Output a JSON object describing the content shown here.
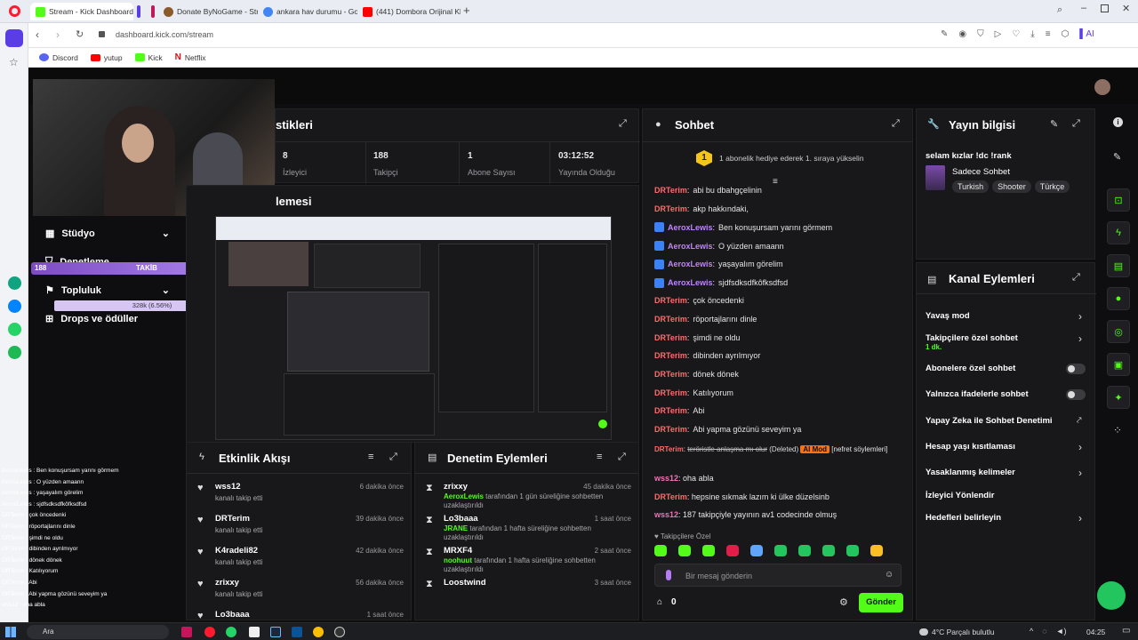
{
  "browser": {
    "tabs": [
      {
        "label": "Stream - Kick Dashboard",
        "active": true
      },
      {
        "label": "Donate ByNoGame - Strea"
      },
      {
        "label": "ankara hav durumu - Goo"
      },
      {
        "label": "(441) Dombora Orijinal Kl"
      }
    ],
    "url": "dashboard.kick.com/stream",
    "bookmarks": [
      "Discord",
      "yutup",
      "Kick",
      "Netflix"
    ]
  },
  "stats": {
    "title": "stikleri",
    "items": [
      {
        "value": "8",
        "label": "İzleyici"
      },
      {
        "value": "188",
        "label": "Takipçi"
      },
      {
        "value": "1",
        "label": "Abone Sayısı"
      },
      {
        "value": "03:12:52",
        "label": "Yayında Olduğu"
      }
    ]
  },
  "preview": {
    "title": "lemesi"
  },
  "left_nav": [
    {
      "label": "Stüdyo"
    },
    {
      "label": "Denetleme"
    },
    {
      "label": "Topluluk"
    },
    {
      "label": "Drops ve ödüller"
    }
  ],
  "follow_goal": {
    "left": "188",
    "center": "TAKİB",
    "right": "200",
    "sub": "328k (6.56%)"
  },
  "chat": {
    "title": "Sohbet",
    "banner": "1 abonelik hediye ederek 1. sıraya yükselin",
    "banner_badge": "1",
    "messages": [
      {
        "user": "DRTerim",
        "text": "abi bu dbahgçelinin",
        "color": "#ff6b6b"
      },
      {
        "user": "DRTerim",
        "text": "akp hakkındaki,",
        "color": "#ff6b6b"
      },
      {
        "user": "AeroxLewis",
        "text": "Ben konuşursam yarını görmem",
        "color": "#c084fc",
        "badge": true
      },
      {
        "user": "AeroxLewis",
        "text": "O yüzden amaann",
        "color": "#c084fc",
        "badge": true
      },
      {
        "user": "AeroxLewis",
        "text": "yaşayalım görelim",
        "color": "#c084fc",
        "badge": true
      },
      {
        "user": "AeroxLewis",
        "text": "sjdfsdksdfkôfksdfsd",
        "color": "#c084fc",
        "badge": true
      },
      {
        "user": "DRTerim",
        "text": "çok öncedenki",
        "color": "#ff6b6b"
      },
      {
        "user": "DRTerim",
        "text": "röportajlarını dinle",
        "color": "#ff6b6b"
      },
      {
        "user": "DRTerim",
        "text": "şimdi ne oldu",
        "color": "#ff6b6b"
      },
      {
        "user": "DRTerim",
        "text": "dibinden ayrılmıyor",
        "color": "#ff6b6b"
      },
      {
        "user": "DRTerim",
        "text": "dönek dönek",
        "color": "#ff6b6b"
      },
      {
        "user": "DRTerim",
        "text": "Katılıyorum",
        "color": "#ff6b6b"
      },
      {
        "user": "DRTerim",
        "text": "Abi",
        "color": "#ff6b6b"
      },
      {
        "user": "DRTerim",
        "text": "Abi yapma gözünü seveyim ya",
        "color": "#ff6b6b"
      }
    ],
    "deleted": {
      "user": "DRTerim",
      "struck": "teröristle anlaşma mı olur",
      "tag": "(Deleted)",
      "ai": "AI Mod",
      "reason": "[nefret söylemleri]"
    },
    "messages2": [
      {
        "user": "wss12",
        "text": "oha abla",
        "color": "#f472b6"
      },
      {
        "user": "DRTerim",
        "text": "hepsine sıkmak lazım ki ülke düzelsinb",
        "color": "#ff6b6b"
      },
      {
        "user": "wss12",
        "text": "187 takipçiyle yayının av1 codecinde olmuş",
        "color": "#f472b6"
      }
    ],
    "followers_only": "Takipçilere Özel",
    "placeholder": "Bir mesaj gönderin",
    "points": "0",
    "send": "Gönder"
  },
  "stream_info": {
    "title": "Yayın bilgisi",
    "stream_title": "selam kızlar !dc !rank",
    "category": "Sadece Sohbet",
    "tags": [
      "Turkish",
      "Shooter",
      "Türkçe"
    ]
  },
  "channel_actions": {
    "title": "Kanal Eylemleri",
    "items": [
      {
        "label": "Yavaş mod",
        "type": "arrow"
      },
      {
        "label": "Takipçilere özel sohbet",
        "sub": "1 dk.",
        "type": "arrow"
      },
      {
        "label": "Abonelere özel sohbet",
        "type": "toggle"
      },
      {
        "label": "Yalnızca ifadelerle sohbet",
        "type": "toggle"
      },
      {
        "label": "Yapay Zeka ile Sohbet Denetimi",
        "type": "link"
      },
      {
        "label": "Hesap yaşı kısıtlaması",
        "type": "arrow"
      },
      {
        "label": "Yasaklanmış kelimeler",
        "type": "arrow"
      },
      {
        "label": "İzleyici Yönlendir",
        "type": "none"
      },
      {
        "label": "Hedefleri belirleyin",
        "type": "arrow"
      }
    ]
  },
  "activity": {
    "title": "Etkinlik Akışı",
    "items": [
      {
        "user": "wss12",
        "action": "kanalı takip etti",
        "time": "6 dakika önce"
      },
      {
        "user": "DRTerim",
        "action": "kanalı takip etti",
        "time": "39 dakika önce"
      },
      {
        "user": "K4radeli82",
        "action": "kanalı takip etti",
        "time": "42 dakika önce"
      },
      {
        "user": "zrixxy",
        "action": "kanalı takip etti",
        "time": "56 dakika önce"
      },
      {
        "user": "Lo3baaa",
        "action": "",
        "time": "1 saat önce"
      }
    ]
  },
  "moderation": {
    "title": "Denetim Eylemleri",
    "items": [
      {
        "user": "zrixxy",
        "mod": "AeroxLewis",
        "text": "tarafından 1 gün süreliğine sohbetten uzaklaştırıldı",
        "time": "45 dakika önce"
      },
      {
        "user": "Lo3baaa",
        "mod": "JRANE",
        "text": "tarafından 1 hafta süreliğine sohbetten uzaklaştırıldı",
        "time": "1 saat önce"
      },
      {
        "user": "MRXF4",
        "mod": "noohuut",
        "text": "tarafından 1 hafta süreliğine sohbetten uzaklaştırıldı",
        "time": "2 saat önce"
      },
      {
        "user": "Loostwind",
        "mod": "",
        "text": "",
        "time": "3 saat önce"
      }
    ]
  },
  "overlay_chat": [
    "AeroxLewis : Ben konuşursam yarını görmem",
    "AeroxLewis : O yüzden amaann",
    "AeroxLewis : yaşayalım görelim",
    "AeroxLewis : sjdfsdksdfkôfksdfsd",
    "DRTerim : çok öncedenki",
    "DRTerim : röportajlarını dinle",
    "DRTerim : şimdi ne oldu",
    "DRTerim : dibinden ayrılmıyor",
    "DRTerim : dönek dönek",
    "DRTerim : Katılıyorum",
    "DRTerim : Abi",
    "DRTerim : Abi yapma gözünü seveyim ya",
    "wss12 : oha abla"
  ],
  "taskbar": {
    "search": "Ara",
    "weather": "4°C  Parçalı bulutlu",
    "time": "04:25"
  },
  "colors": {
    "kick_green": "#53fc18",
    "panel": "#18181b",
    "bg": "#0e0e10"
  }
}
